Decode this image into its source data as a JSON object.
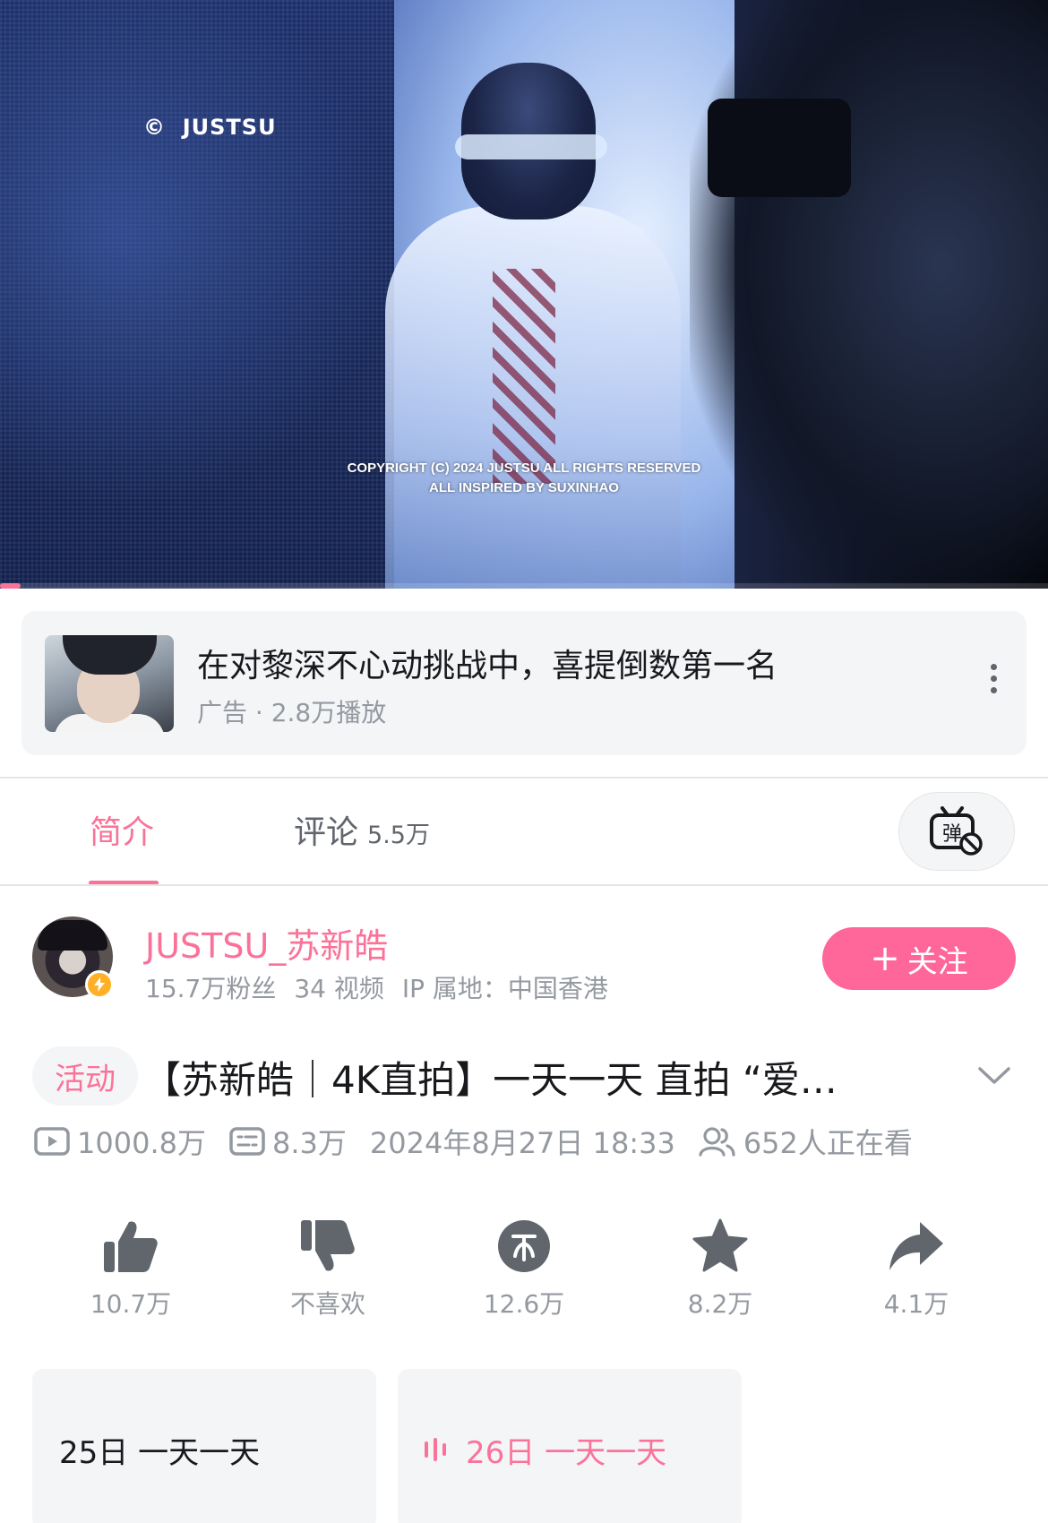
{
  "player": {
    "watermark_symbol": "©",
    "watermark_brand": "JUSTSU",
    "copyright_line1": "COPYRIGHT (C) 2024 JUSTSU ALL RIGHTS RESERVED",
    "copyright_line2": "ALL INSPIRED BY SUXINHAO",
    "progress_fraction": 0.02
  },
  "ad": {
    "title": "在对黎深不心动挑战中，喜提倒数第一名",
    "subtitle": "广告 · 2.8万播放",
    "more_icon": "more-vertical-icon"
  },
  "tabs": {
    "intro_label": "简介",
    "comments_label": "评论",
    "comments_count": "5.5万",
    "danmaku_icon": "danmaku-off-icon"
  },
  "uploader": {
    "name": "JUSTSU_苏新皓",
    "fans": "15.7万粉丝",
    "videos": "34 视频",
    "ip": "IP 属地：中国香港",
    "follow_label": "关注",
    "accent": "#fb7299",
    "badge_color": "#ffb027"
  },
  "video": {
    "tag": "活动",
    "title": "【苏新皓｜4K直拍】一天一天 直拍 “爱…",
    "plays": "1000.8万",
    "danmaku": "8.3万",
    "date": "2024年8月27日 18:33",
    "watching": "652人正在看"
  },
  "actions": {
    "like": "10.7万",
    "dislike": "不喜欢",
    "coin": "12.6万",
    "favorite": "8.2万",
    "share": "4.1万"
  },
  "episodes": [
    {
      "label": "25日 一天一天",
      "active": false
    },
    {
      "label": "26日 一天一天",
      "active": true
    }
  ]
}
